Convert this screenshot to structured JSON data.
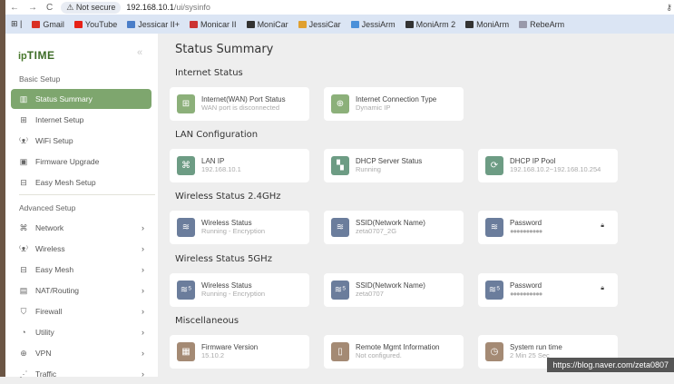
{
  "browser": {
    "security": "Not secure",
    "url_host": "192.168.10.1",
    "url_path": "/ui/sysinfo",
    "bookmarks": [
      {
        "label": "Gmail",
        "color": "#d93025"
      },
      {
        "label": "YouTube",
        "color": "#e62117"
      },
      {
        "label": "Jessicar II+",
        "color": "#4a7ec9"
      },
      {
        "label": "Monicar II",
        "color": "#c33"
      },
      {
        "label": "MoniCar",
        "color": "#333"
      },
      {
        "label": "JessiCar",
        "color": "#e0a030"
      },
      {
        "label": "JessiArm",
        "color": "#4a90d9"
      },
      {
        "label": "MoniArm 2",
        "color": "#333"
      },
      {
        "label": "MoniArm",
        "color": "#333"
      },
      {
        "label": "RebeArm",
        "color": "#99a"
      }
    ]
  },
  "sidebar": {
    "logo_prefix": "ip",
    "logo_main": "TIME",
    "basic_header": "Basic Setup",
    "advanced_header": "Advanced Setup",
    "basic": [
      {
        "label": "Status Summary",
        "icon": "bar-chart-icon"
      },
      {
        "label": "Internet Setup",
        "icon": "internet-icon"
      },
      {
        "label": "WiFi Setup",
        "icon": "antenna-icon"
      },
      {
        "label": "Firmware Upgrade",
        "icon": "firmware-icon"
      },
      {
        "label": "Easy Mesh Setup",
        "icon": "mesh-icon"
      }
    ],
    "advanced": [
      {
        "label": "Network",
        "icon": "network-icon"
      },
      {
        "label": "Wireless",
        "icon": "antenna-icon"
      },
      {
        "label": "Easy Mesh",
        "icon": "mesh-icon"
      },
      {
        "label": "NAT/Routing",
        "icon": "router-icon"
      },
      {
        "label": "Firewall",
        "icon": "shield-icon"
      },
      {
        "label": "Utility",
        "icon": "gauge-icon"
      },
      {
        "label": "VPN",
        "icon": "vpn-icon"
      },
      {
        "label": "Traffic",
        "icon": "traffic-icon"
      }
    ]
  },
  "main": {
    "title": "Status Summary",
    "groups": [
      {
        "title": "Internet Status",
        "cards": [
          {
            "title": "Internet(WAN) Port Status",
            "value": "WAN port is disconnected",
            "icon": "wan-port-icon",
            "color": "green"
          },
          {
            "title": "Internet Connection Type",
            "value": "Dynamic IP",
            "icon": "connection-type-icon",
            "color": "green"
          }
        ]
      },
      {
        "title": "LAN Configuration",
        "cards": [
          {
            "title": "LAN IP",
            "value": "192.168.10.1",
            "icon": "lan-icon",
            "color": "teal"
          },
          {
            "title": "DHCP Server Status",
            "value": "Running",
            "icon": "dhcp-server-icon",
            "color": "teal"
          },
          {
            "title": "DHCP IP Pool",
            "value": "192.168.10.2~192.168.10.254",
            "icon": "ip-pool-icon",
            "color": "teal"
          }
        ]
      },
      {
        "title": "Wireless Status 2.4GHz",
        "cards": [
          {
            "title": "Wireless Status",
            "value": "Running - Encryption",
            "icon": "wifi-icon",
            "color": "blue"
          },
          {
            "title": "SSID(Network Name)",
            "value": "zeta0707_2G",
            "icon": "wifi-icon",
            "color": "blue"
          },
          {
            "title": "Password",
            "value": "●●●●●●●●●●",
            "icon": "wifi-icon",
            "color": "blue",
            "lock": true
          }
        ]
      },
      {
        "title": "Wireless Status 5GHz",
        "cards": [
          {
            "title": "Wireless Status",
            "value": "Running - Encryption",
            "icon": "wifi-5g-icon",
            "color": "blue"
          },
          {
            "title": "SSID(Network Name)",
            "value": "zeta0707",
            "icon": "wifi-5g-icon",
            "color": "blue"
          },
          {
            "title": "Password",
            "value": "●●●●●●●●●●",
            "icon": "wifi-5g-icon",
            "color": "blue",
            "lock": true
          }
        ]
      },
      {
        "title": "Miscellaneous",
        "cards": [
          {
            "title": "Firmware Version",
            "value": "15.10.2",
            "icon": "chip-icon",
            "color": "brown"
          },
          {
            "title": "Remote Mgmt Information",
            "value": "Not configured.",
            "icon": "remote-icon",
            "color": "brown"
          },
          {
            "title": "System run time",
            "value": "2 Min 25 Sec",
            "icon": "clock-icon",
            "color": "brown"
          }
        ]
      }
    ]
  },
  "watermark": "https://blog.naver.com/zeta0807"
}
